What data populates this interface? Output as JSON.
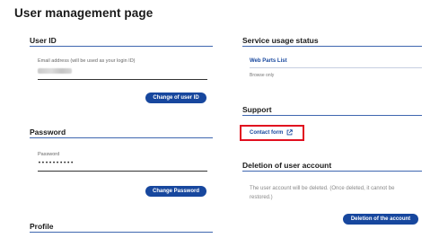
{
  "page": {
    "title": "User management page"
  },
  "user_id": {
    "heading": "User ID",
    "email_label": "Email address (will be used as your login ID)",
    "change_button": "Change of user ID"
  },
  "password": {
    "heading": "Password",
    "field_label": "Password",
    "value": "••••••••••",
    "change_button": "Change Password"
  },
  "profile": {
    "heading": "Profile"
  },
  "service": {
    "heading": "Service usage status",
    "link": "Web Parts List",
    "note": "Browse only"
  },
  "support": {
    "heading": "Support",
    "contact_link": "Contact form",
    "highlight_color": "#e10f1f"
  },
  "deletion": {
    "heading": "Deletion of user account",
    "line1": "The user account will be deleted. (Once deleted, it cannot be",
    "line2": "restored.)",
    "button": "Deletion of the account"
  },
  "colors": {
    "accent": "#17479e",
    "rule": "#3f67b0"
  },
  "icons": {
    "external_link": "external-link-icon"
  }
}
